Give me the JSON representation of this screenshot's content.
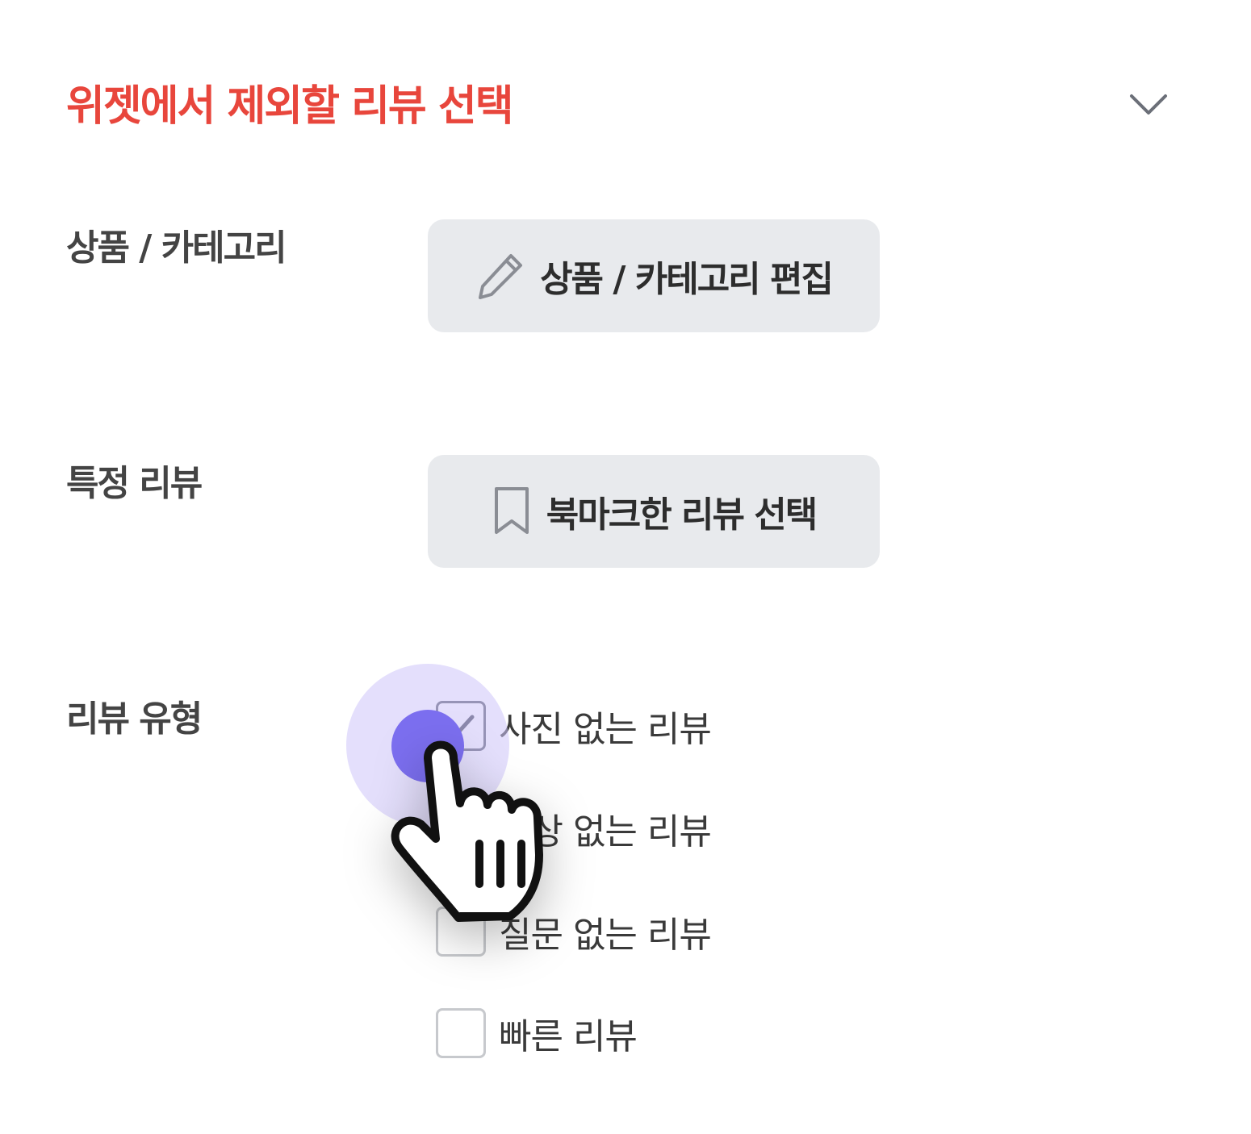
{
  "header": {
    "title": "위젯에서 제외할 리뷰 선택",
    "title_color": "#e8463c",
    "toggle_icon": "chevron-down-icon"
  },
  "rows": {
    "product_category": {
      "label": "상품 / 카테고리",
      "button_label": "상품 / 카테고리 편집",
      "button_icon": "pencil-icon"
    },
    "specific_review": {
      "label": "특정 리뷰",
      "button_label": "북마크한 리뷰 선택",
      "button_icon": "bookmark-icon"
    },
    "review_type": {
      "label": "리뷰 유형",
      "options": [
        {
          "label": "사진 없는 리뷰",
          "checked": true
        },
        {
          "label": "영상 없는 리뷰",
          "checked": false
        },
        {
          "label": "질문 없는 리뷰",
          "checked": false
        },
        {
          "label": "빠른 리뷰",
          "checked": false
        }
      ]
    }
  },
  "pointer": {
    "icon": "hand-pointer-icon",
    "click_color": "#7c6ff0"
  }
}
